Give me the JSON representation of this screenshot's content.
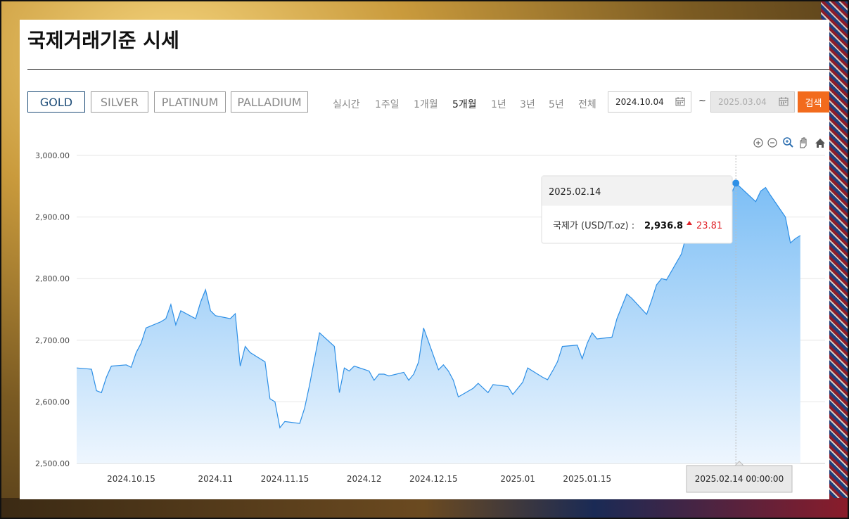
{
  "page": {
    "title": "국제거래기준 시세",
    "metals": [
      "GOLD",
      "SILVER",
      "PLATINUM",
      "PALLADIUM"
    ],
    "periods": [
      "실시간",
      "1주일",
      "1개월",
      "5개월",
      "1년",
      "3년",
      "5년",
      "전체"
    ],
    "active_period": "5개월",
    "date_from": "2024.10.04",
    "date_to": "2025.03.04",
    "tilde": "~",
    "search_label": "검색"
  },
  "chart_data": {
    "type": "area",
    "ylim": [
      2500,
      3000
    ],
    "yticks": [
      "2,500.00",
      "2,600.00",
      "2,700.00",
      "2,800.00",
      "2,900.00",
      "3,000.00"
    ],
    "xticks": [
      "2024.10.15",
      "2024.11",
      "2024.11.15",
      "2024.12",
      "2024.12.15",
      "2025.01",
      "2025.01.15",
      "2025.02.14 00:00:00"
    ],
    "x": [
      "2024.10.04",
      "2024.10.07",
      "2024.10.08",
      "2024.10.09",
      "2024.10.10",
      "2024.10.11",
      "2024.10.14",
      "2024.10.15",
      "2024.10.16",
      "2024.10.17",
      "2024.10.18",
      "2024.10.21",
      "2024.10.22",
      "2024.10.23",
      "2024.10.24",
      "2024.10.25",
      "2024.10.28",
      "2024.10.29",
      "2024.10.30",
      "2024.10.31",
      "2024.11.01",
      "2024.11.04",
      "2024.11.05",
      "2024.11.06",
      "2024.11.07",
      "2024.11.08",
      "2024.11.11",
      "2024.11.12",
      "2024.11.13",
      "2024.11.14",
      "2024.11.15",
      "2024.11.18",
      "2024.11.19",
      "2024.11.20",
      "2024.11.21",
      "2024.11.22",
      "2024.11.25",
      "2024.11.26",
      "2024.11.27",
      "2024.11.28",
      "2024.11.29",
      "2024.12.02",
      "2024.12.03",
      "2024.12.04",
      "2024.12.05",
      "2024.12.06",
      "2024.12.09",
      "2024.12.10",
      "2024.12.11",
      "2024.12.12",
      "2024.12.13",
      "2024.12.16",
      "2024.12.17",
      "2024.12.18",
      "2024.12.19",
      "2024.12.20",
      "2024.12.23",
      "2024.12.24",
      "2024.12.26",
      "2024.12.27",
      "2024.12.30",
      "2024.12.31",
      "2025.01.02",
      "2025.01.03",
      "2025.01.06",
      "2025.01.07",
      "2025.01.08",
      "2025.01.09",
      "2025.01.10",
      "2025.01.13",
      "2025.01.14",
      "2025.01.15",
      "2025.01.16",
      "2025.01.17",
      "2025.01.20",
      "2025.01.21",
      "2025.01.22",
      "2025.01.23",
      "2025.01.24",
      "2025.01.27",
      "2025.01.28",
      "2025.01.29",
      "2025.01.30",
      "2025.01.31",
      "2025.02.03",
      "2025.02.04",
      "2025.02.05",
      "2025.02.06",
      "2025.02.07",
      "2025.02.10",
      "2025.02.11",
      "2025.02.12",
      "2025.02.13",
      "2025.02.14",
      "2025.02.18",
      "2025.02.19",
      "2025.02.20",
      "2025.02.21",
      "2025.02.24",
      "2025.02.25",
      "2025.02.26",
      "2025.02.27",
      "2025.02.28",
      "2025.03.03",
      "2025.03.04"
    ],
    "series": [
      {
        "name": "국제가 (USD/T.oz)",
        "color": "#2d8fe6",
        "values": [
          2655,
          2653,
          2618,
          2615,
          2640,
          2658,
          2660,
          2656,
          2680,
          2695,
          2720,
          2730,
          2735,
          2758,
          2725,
          2748,
          2735,
          2762,
          2782,
          2748,
          2740,
          2735,
          2743,
          2658,
          2690,
          2680,
          2665,
          2605,
          2600,
          2558,
          2568,
          2565,
          2590,
          2628,
          2670,
          2712,
          2690,
          2615,
          2655,
          2650,
          2658,
          2650,
          2635,
          2645,
          2645,
          2642,
          2648,
          2635,
          2645,
          2665,
          2720,
          2652,
          2660,
          2650,
          2635,
          2608,
          2622,
          2630,
          2615,
          2628,
          2625,
          2612,
          2632,
          2655,
          2640,
          2636,
          2650,
          2665,
          2690,
          2692,
          2670,
          2695,
          2712,
          2702,
          2705,
          2735,
          2755,
          2775,
          2768,
          2742,
          2765,
          2790,
          2800,
          2798,
          2840,
          2870,
          2880,
          2895,
          2912,
          2936.8,
          2888,
          2905,
          2936,
          2955,
          2925,
          2942,
          2948,
          2935,
          2900,
          2858,
          2865,
          2870
        ]
      }
    ],
    "tooltip": {
      "date": "2025.02.14",
      "label": "국제가 (USD/T.oz) :",
      "value": "2,936.8",
      "change": "23.81",
      "change_color": "#e0242a",
      "index": 93
    }
  }
}
